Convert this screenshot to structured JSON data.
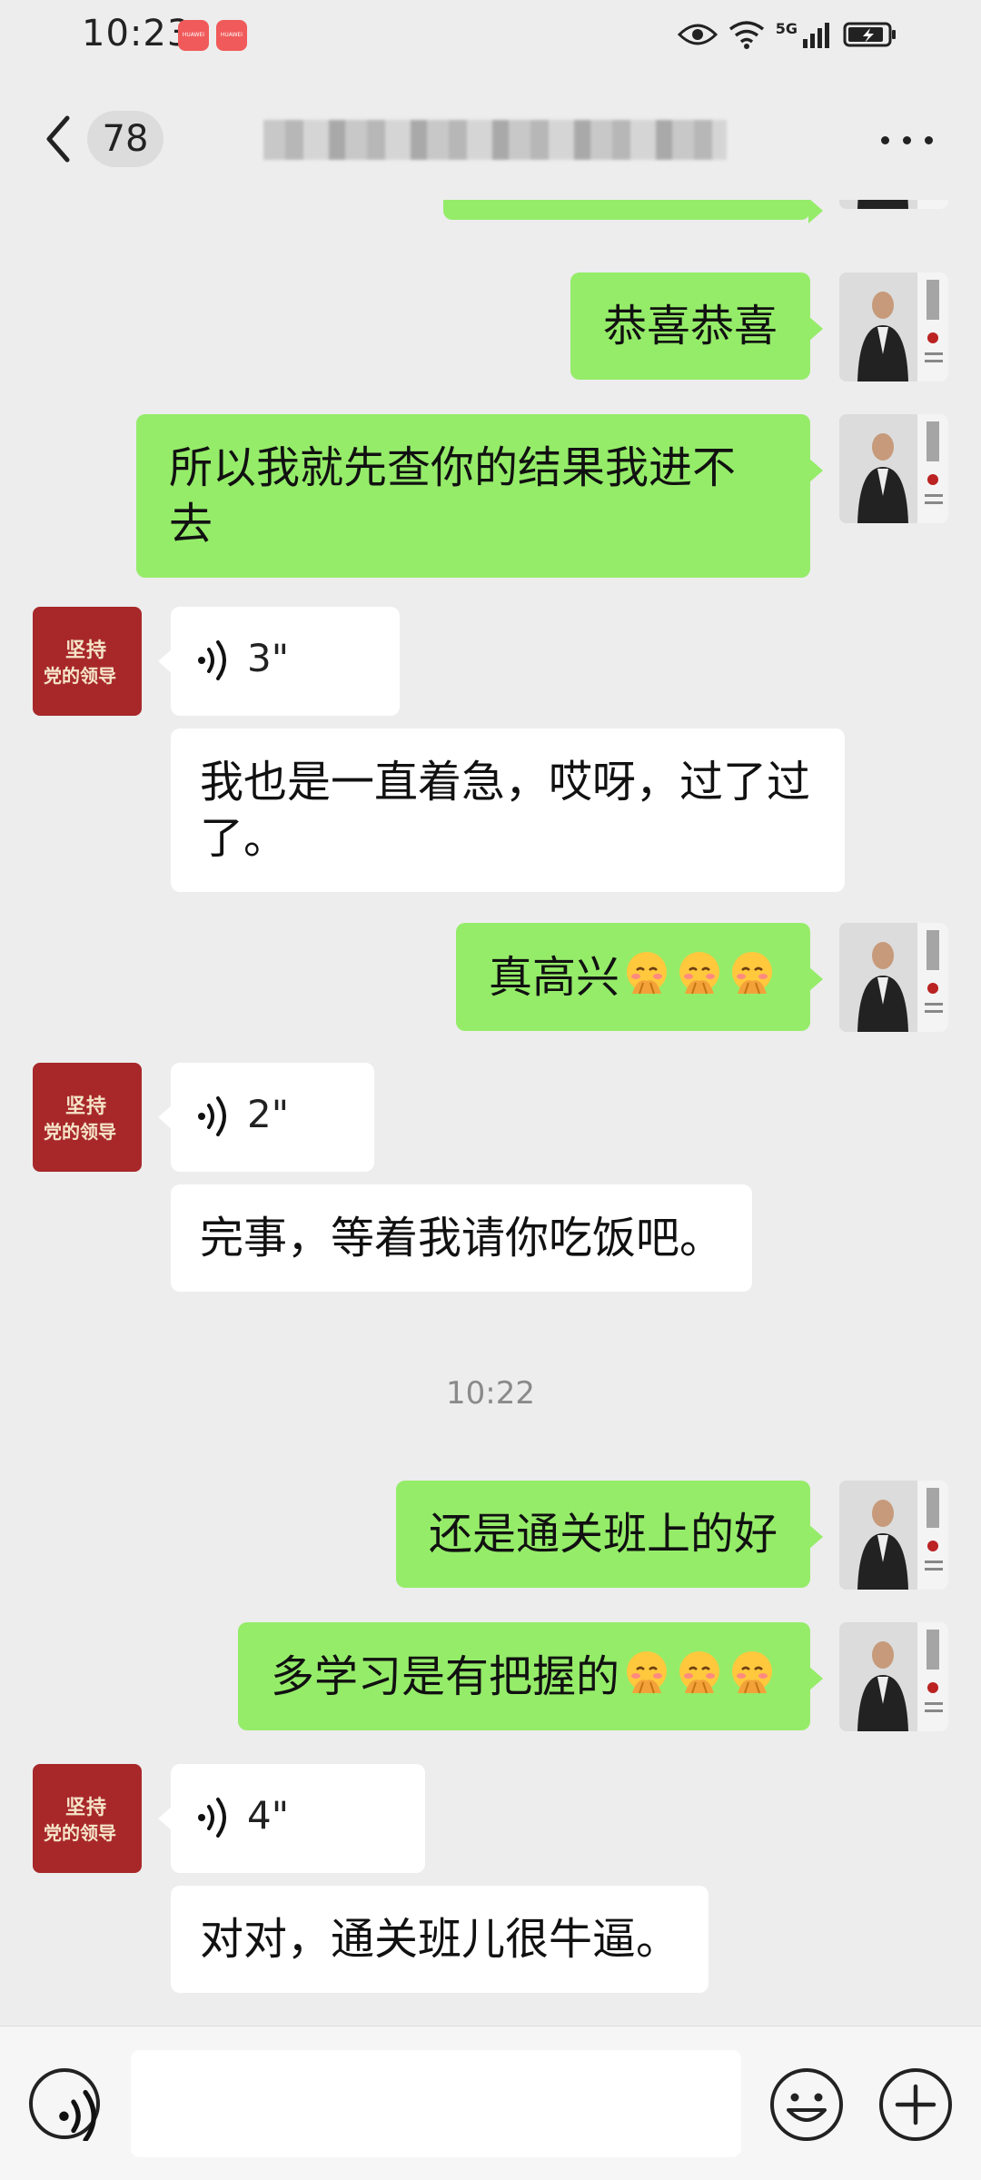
{
  "status_bar": {
    "time": "10:23",
    "app_badges": [
      "HUAWEI",
      "HUAWEI"
    ],
    "network": "5G",
    "icons": [
      "eye-icon",
      "wifi-icon",
      "signal-icon",
      "battery-charging-icon"
    ]
  },
  "header": {
    "back_icon": "chevron-left-icon",
    "unread_count": "78",
    "title": "",
    "more_icon": "more-dots-icon"
  },
  "other_avatar": {
    "line1": "坚持",
    "line2": "党的领导"
  },
  "messages": [
    {
      "sender": "me",
      "type": "text",
      "text": "恭喜恭喜"
    },
    {
      "sender": "me",
      "type": "text",
      "text": "所以我就先查你的结果我进不去"
    },
    {
      "sender": "other",
      "type": "voice",
      "duration": "3\""
    },
    {
      "sender": "other",
      "type": "text",
      "text": "我也是一直着急，哎呀，过了过了。"
    },
    {
      "sender": "me",
      "type": "text",
      "text": "真高兴",
      "emoji": [
        "shy-face-emoji",
        "shy-face-emoji",
        "shy-face-emoji"
      ]
    },
    {
      "sender": "other",
      "type": "voice",
      "duration": "2\""
    },
    {
      "sender": "other",
      "type": "text",
      "text": "完事，等着我请你吃饭吧。"
    },
    {
      "sender": "system",
      "type": "timestamp",
      "text": "10:22"
    },
    {
      "sender": "me",
      "type": "text",
      "text": "还是通关班上的好"
    },
    {
      "sender": "me",
      "type": "text",
      "text": "多学习是有把握的",
      "emoji": [
        "shy-face-emoji",
        "shy-face-emoji",
        "shy-face-emoji"
      ]
    },
    {
      "sender": "other",
      "type": "voice",
      "duration": "4\""
    },
    {
      "sender": "other",
      "type": "text",
      "text": "对对，通关班儿很牛逼。"
    }
  ],
  "input_bar": {
    "value": "",
    "left_icon": "voice-mode-icon",
    "emoji_icon": "emoji-icon",
    "plus_icon": "plus-icon"
  },
  "colors": {
    "background": "#ededed",
    "my_bubble": "#95ec69",
    "other_bubble": "#ffffff",
    "other_avatar": "#a8282a"
  }
}
